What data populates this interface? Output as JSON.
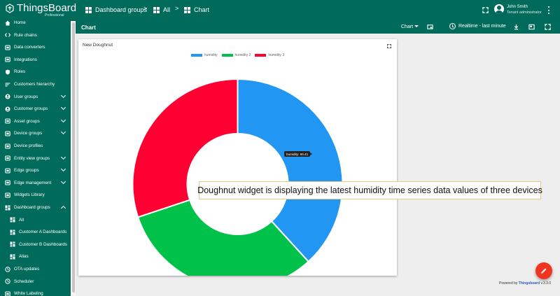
{
  "app": {
    "logo_text": "ThingsBoard",
    "logo_sub": "Professional"
  },
  "breadcrumb": {
    "item1": "Dashboard groups",
    "item2": "All",
    "item3": "Chart",
    "separator": ">"
  },
  "user": {
    "name": "John Smith",
    "role": "Tenant administrator"
  },
  "sidebar": {
    "items": [
      {
        "label": "Home",
        "icon": "home-icon"
      },
      {
        "label": "Rule chains",
        "icon": "code-icon"
      },
      {
        "label": "Data converters",
        "icon": "converter-icon"
      },
      {
        "label": "Integrations",
        "icon": "input-icon"
      },
      {
        "label": "Roles",
        "icon": "shield-icon"
      },
      {
        "label": "Customers hierarchy",
        "icon": "sort-icon"
      },
      {
        "label": "User groups",
        "icon": "account-icon"
      },
      {
        "label": "Customer groups",
        "icon": "supervisor-icon"
      },
      {
        "label": "Asset groups",
        "icon": "domain-icon"
      },
      {
        "label": "Device groups",
        "icon": "devices-icon"
      },
      {
        "label": "Device profiles",
        "icon": "memory-icon"
      },
      {
        "label": "Entity view groups",
        "icon": "view-quilt-icon"
      },
      {
        "label": "Edge groups",
        "icon": "router-icon"
      },
      {
        "label": "Edge management",
        "icon": "settings-input-icon"
      },
      {
        "label": "Widgets Library",
        "icon": "widgets-icon"
      },
      {
        "label": "Dashboard groups",
        "icon": "dashboard-icon"
      },
      {
        "label": "All",
        "icon": "dashboard-icon"
      },
      {
        "label": "Customer A Dashboards",
        "icon": "dashboard-icon"
      },
      {
        "label": "Customer B Dashboards",
        "icon": "dashboard-icon"
      },
      {
        "label": "Alias",
        "icon": "dashboard-icon"
      },
      {
        "label": "OTA updates",
        "icon": "update-icon"
      },
      {
        "label": "Scheduler",
        "icon": "schedule-icon"
      },
      {
        "label": "White Labeling",
        "icon": "format-paint-icon"
      }
    ]
  },
  "header": {
    "title": "Chart",
    "chart_menu": "Chart",
    "realtime": "Realtime - last minute"
  },
  "widget": {
    "title": "New Doughnut",
    "tooltip": "humidity: 66.41"
  },
  "chart_data": {
    "type": "pie",
    "variant": "doughnut",
    "categories": [
      "humidity",
      "humidity 2",
      "humidity 3"
    ],
    "values": [
      66.41,
      55.0,
      52.3
    ],
    "colors": [
      "#2196f3",
      "#00c24a",
      "#ff0033"
    ],
    "legend": "top"
  },
  "caption": "Doughnut widget is displaying the latest humidity time series data values of three devices",
  "footer": {
    "powered": "Powered by ",
    "link": "Thingsboard",
    "version": " v.3.3.0"
  },
  "colors": {
    "primary": "#006b5b",
    "fab": "#f0341f"
  }
}
